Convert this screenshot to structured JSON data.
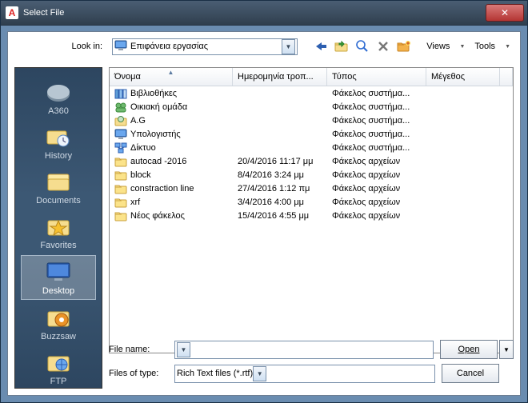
{
  "window": {
    "title": "Select File"
  },
  "toprow": {
    "lookin_label": "Look in:",
    "lookin_value": "Επιφάνεια εργασίας",
    "views_label": "Views",
    "tools_label": "Tools"
  },
  "places": [
    {
      "label": "A360"
    },
    {
      "label": "History"
    },
    {
      "label": "Documents"
    },
    {
      "label": "Favorites"
    },
    {
      "label": "Desktop",
      "selected": true
    },
    {
      "label": "Buzzsaw"
    },
    {
      "label": "FTP"
    }
  ],
  "columns": {
    "name": "Όνομα",
    "date": "Ημερομηνία τροπ...",
    "type": "Τύπος",
    "size": "Μέγεθος"
  },
  "rows": [
    {
      "icon": "lib",
      "name": "Βιβλιοθήκες",
      "date": "",
      "type": "Φάκελος συστήμα..."
    },
    {
      "icon": "home",
      "name": "Οικιακή ομάδα",
      "date": "",
      "type": "Φάκελος συστήμα..."
    },
    {
      "icon": "user",
      "name": "A.G",
      "date": "",
      "type": "Φάκελος συστήμα..."
    },
    {
      "icon": "pc",
      "name": "Υπολογιστής",
      "date": "",
      "type": "Φάκελος συστήμα..."
    },
    {
      "icon": "net",
      "name": "Δίκτυο",
      "date": "",
      "type": "Φάκελος συστήμα..."
    },
    {
      "icon": "folder",
      "name": "autocad -2016",
      "date": "20/4/2016 11:17 μμ",
      "type": "Φάκελος αρχείων"
    },
    {
      "icon": "folder",
      "name": "block",
      "date": "8/4/2016 3:24 μμ",
      "type": "Φάκελος αρχείων"
    },
    {
      "icon": "folder",
      "name": "constraction line",
      "date": "27/4/2016 1:12 πμ",
      "type": "Φάκελος αρχείων"
    },
    {
      "icon": "folder",
      "name": "xrf",
      "date": "3/4/2016 4:00 μμ",
      "type": "Φάκελος αρχείων"
    },
    {
      "icon": "folder",
      "name": "Νέος φάκελος",
      "date": "15/4/2016 4:55 μμ",
      "type": "Φάκελος αρχείων"
    }
  ],
  "bottom": {
    "filename_label": "File name:",
    "filename_value": "",
    "type_label": "Files of type:",
    "type_value": "Rich Text files (*.rtf)",
    "open_label": "Open",
    "cancel_label": "Cancel"
  }
}
